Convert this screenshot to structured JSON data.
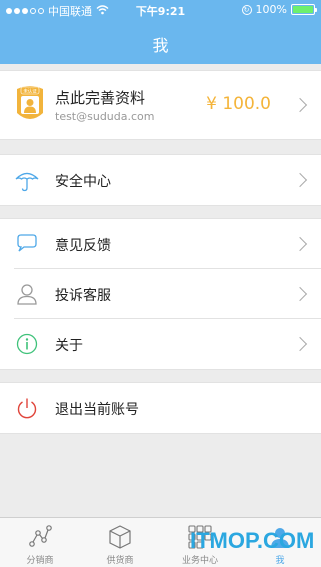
{
  "status_bar": {
    "carrier": "中国联通",
    "time": "下午9:21",
    "battery": "100%",
    "wifi_icon": "wifi-icon"
  },
  "nav": {
    "title": "我"
  },
  "profile": {
    "name": "点此完善资料",
    "email": "test@sududa.com",
    "balance": "¥ 100.0",
    "avatar_badge": "未认证"
  },
  "menu": {
    "security": "安全中心",
    "feedback": "意见反馈",
    "complaint": "投诉客服",
    "about": "关于",
    "logout": "退出当前账号"
  },
  "tabs": [
    {
      "label": "分销商",
      "icon": "distributor-icon"
    },
    {
      "label": "供货商",
      "icon": "supplier-box-icon"
    },
    {
      "label": "业务中心",
      "icon": "grid-icon"
    },
    {
      "label": "我",
      "icon": "person-icon"
    }
  ],
  "watermark": "ITMOP.COM",
  "colors": {
    "header": "#6ab7ee",
    "accent": "#4ea8e8",
    "balance": "#f4b43a",
    "logout": "#e0453b"
  }
}
